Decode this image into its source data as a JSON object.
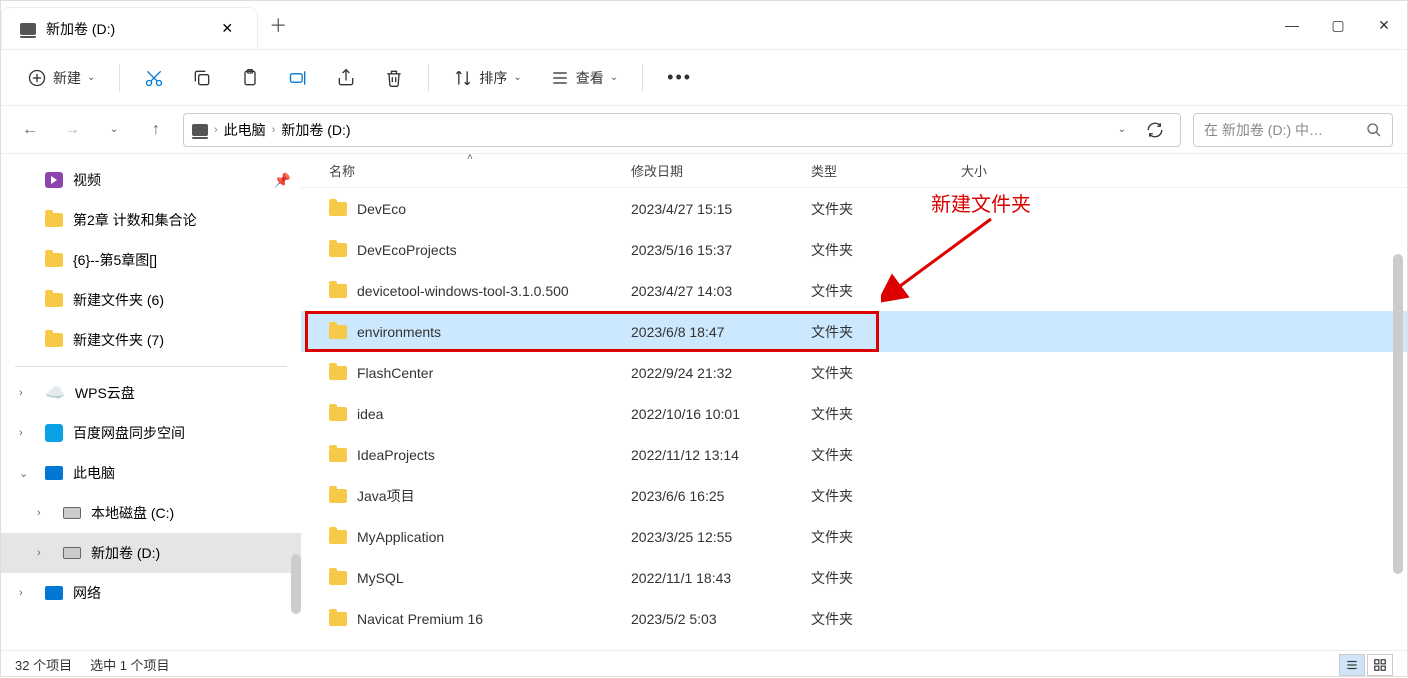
{
  "window": {
    "title": "新加卷 (D:)"
  },
  "toolbar": {
    "new_label": "新建",
    "sort_label": "排序",
    "view_label": "查看"
  },
  "breadcrumb": {
    "seg1": "此电脑",
    "seg2": "新加卷 (D:)"
  },
  "search": {
    "placeholder": "在 新加卷 (D:) 中…"
  },
  "sidebar": {
    "items": [
      {
        "label": "视频",
        "kind": "video",
        "pinned": true
      },
      {
        "label": "第2章 计数和集合论",
        "kind": "folder"
      },
      {
        "label": "{6}--第5章图[]",
        "kind": "folder"
      },
      {
        "label": "新建文件夹 (6)",
        "kind": "folder"
      },
      {
        "label": "新建文件夹 (7)",
        "kind": "folder"
      }
    ],
    "drives": [
      {
        "label": "WPS云盘",
        "kind": "wps",
        "expander": ">"
      },
      {
        "label": "百度网盘同步空间",
        "kind": "baidu",
        "expander": ">"
      },
      {
        "label": "此电脑",
        "kind": "pc",
        "expander": "v",
        "children": [
          {
            "label": "本地磁盘 (C:)",
            "kind": "disk",
            "expander": ">"
          },
          {
            "label": "新加卷 (D:)",
            "kind": "disk",
            "expander": ">",
            "selected": true
          }
        ]
      },
      {
        "label": "网络",
        "kind": "net",
        "expander": ">"
      }
    ]
  },
  "columns": {
    "name": "名称",
    "date": "修改日期",
    "type": "类型",
    "size": "大小"
  },
  "rows": [
    {
      "name": "DevEco",
      "date": "2023/4/27 15:15",
      "type": "文件夹"
    },
    {
      "name": "DevEcoProjects",
      "date": "2023/5/16 15:37",
      "type": "文件夹"
    },
    {
      "name": "devicetool-windows-tool-3.1.0.500",
      "date": "2023/4/27 14:03",
      "type": "文件夹"
    },
    {
      "name": "environments",
      "date": "2023/6/8 18:47",
      "type": "文件夹",
      "selected": true,
      "highlighted": true
    },
    {
      "name": "FlashCenter",
      "date": "2022/9/24 21:32",
      "type": "文件夹"
    },
    {
      "name": "idea",
      "date": "2022/10/16 10:01",
      "type": "文件夹"
    },
    {
      "name": "IdeaProjects",
      "date": "2022/11/12 13:14",
      "type": "文件夹"
    },
    {
      "name": "Java项目",
      "date": "2023/6/6 16:25",
      "type": "文件夹"
    },
    {
      "name": "MyApplication",
      "date": "2023/3/25 12:55",
      "type": "文件夹"
    },
    {
      "name": "MySQL",
      "date": "2022/11/1 18:43",
      "type": "文件夹"
    },
    {
      "name": "Navicat Premium 16",
      "date": "2023/5/2 5:03",
      "type": "文件夹"
    }
  ],
  "annotation": {
    "label": "新建文件夹"
  },
  "status": {
    "count": "32 个项目",
    "selected": "选中 1 个项目"
  }
}
